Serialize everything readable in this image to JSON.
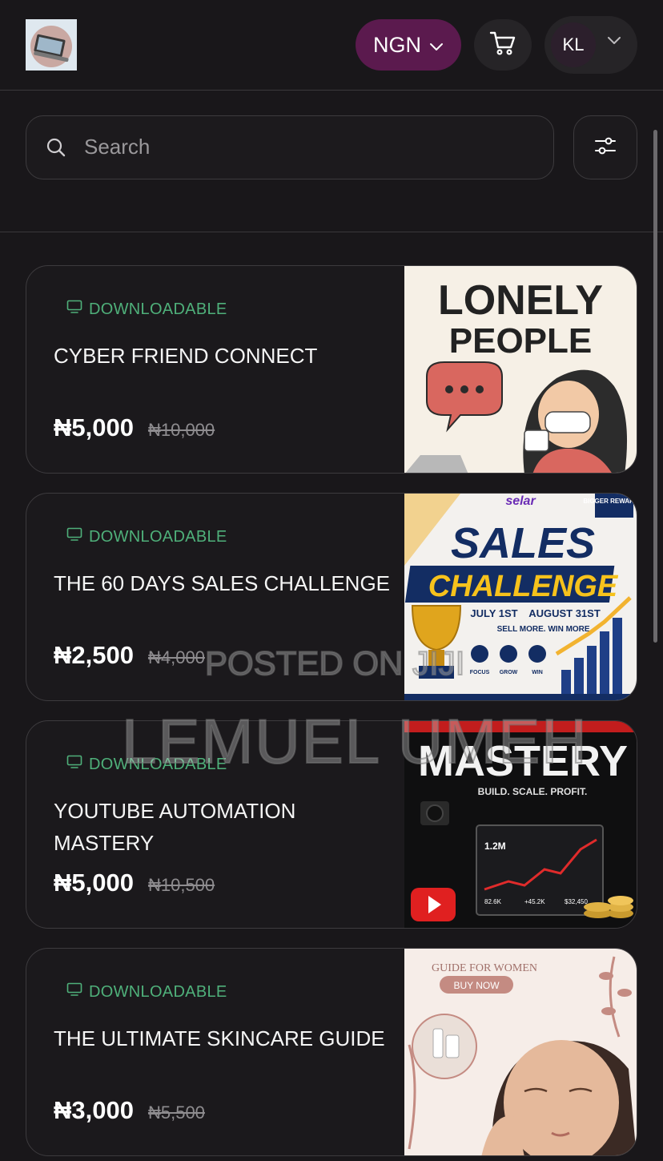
{
  "header": {
    "currency": "NGN",
    "avatar_initials": "KL"
  },
  "search": {
    "placeholder": "Search",
    "value": ""
  },
  "products": [
    {
      "badge": "DOWNLOADABLE",
      "title": "CYBER FRIEND CONNECT",
      "price": "₦5,000",
      "old_price": "₦10,000",
      "image_text": [
        "LONELY",
        "PEOPLE"
      ]
    },
    {
      "badge": "DOWNLOADABLE",
      "title": "THE 60 DAYS SALES CHALLENGE",
      "price": "₦2,500",
      "old_price": "₦4,000",
      "image_text": [
        "selar",
        "BIGGER REWARDS!",
        "SALES",
        "CHALLENGE",
        "JULY 1ST",
        "AUGUST 31ST",
        "SELL MORE. WIN MORE.",
        "FOCUS",
        "GROW",
        "WIN"
      ]
    },
    {
      "badge": "DOWNLOADABLE",
      "title": "YOUTUBE AUTOMATION MASTERY",
      "price": "₦5,000",
      "old_price": "₦10,500",
      "image_text": [
        "MASTERY",
        "BUILD. SCALE. PROFIT.",
        "1.2M",
        "82.6K",
        "+45.2K",
        "$32,450"
      ]
    },
    {
      "badge": "DOWNLOADABLE",
      "title": "THE ULTIMATE SKINCARE GUIDE",
      "price": "₦3,000",
      "old_price": "₦5,500",
      "image_text": [
        "GUIDE FOR WOMEN",
        "BUY NOW"
      ]
    }
  ],
  "watermark": {
    "line1": "POSTED ON JIJI",
    "line2": "LEMUEL UMEH"
  },
  "colors": {
    "background": "#19171a",
    "accent": "#5b1a4e",
    "badge": "#4fb07a"
  }
}
